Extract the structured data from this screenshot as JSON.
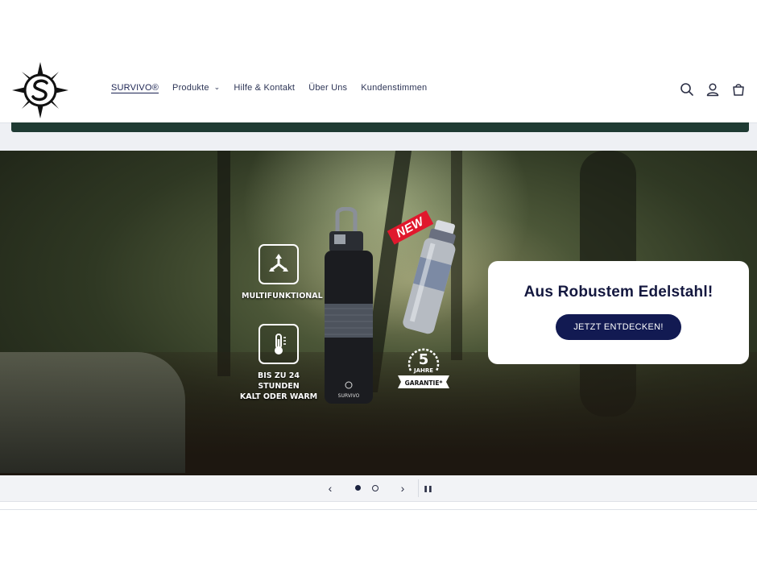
{
  "nav": {
    "items": [
      {
        "label": "SURVIVO®",
        "active": true,
        "dropdown": false
      },
      {
        "label": "Produkte",
        "active": false,
        "dropdown": true
      },
      {
        "label": "Hilfe & Kontakt",
        "active": false,
        "dropdown": false
      },
      {
        "label": "Über Uns",
        "active": false,
        "dropdown": false
      },
      {
        "label": "Kundenstimmen",
        "active": false,
        "dropdown": false
      }
    ]
  },
  "header_icons": [
    "search-icon",
    "account-icon",
    "cart-icon"
  ],
  "hero": {
    "features": [
      {
        "label_line1": "MULTIFUNKTIONAL",
        "label_line2": ""
      },
      {
        "label_line1": "BIS ZU 24 STUNDEN",
        "label_line2": "KALT ODER WARM"
      }
    ],
    "badge_new": "NEW",
    "bottle_brand": "SURVIVO",
    "warranty": {
      "number": "5",
      "unit": "JAHRE",
      "label": "GARANTIE*"
    }
  },
  "promo": {
    "heading": "Aus Robustem Edelstahl!",
    "button_label": "JETZT ENTDECKEN!"
  },
  "slider": {
    "prev_label": "‹",
    "next_label": "›",
    "pause_label": "❚❚",
    "slide_count": 2,
    "active_slide": 1
  },
  "colors": {
    "brand_navy": "#121a52",
    "forest_green": "#1f3b33",
    "badge_red": "#e0182d"
  }
}
